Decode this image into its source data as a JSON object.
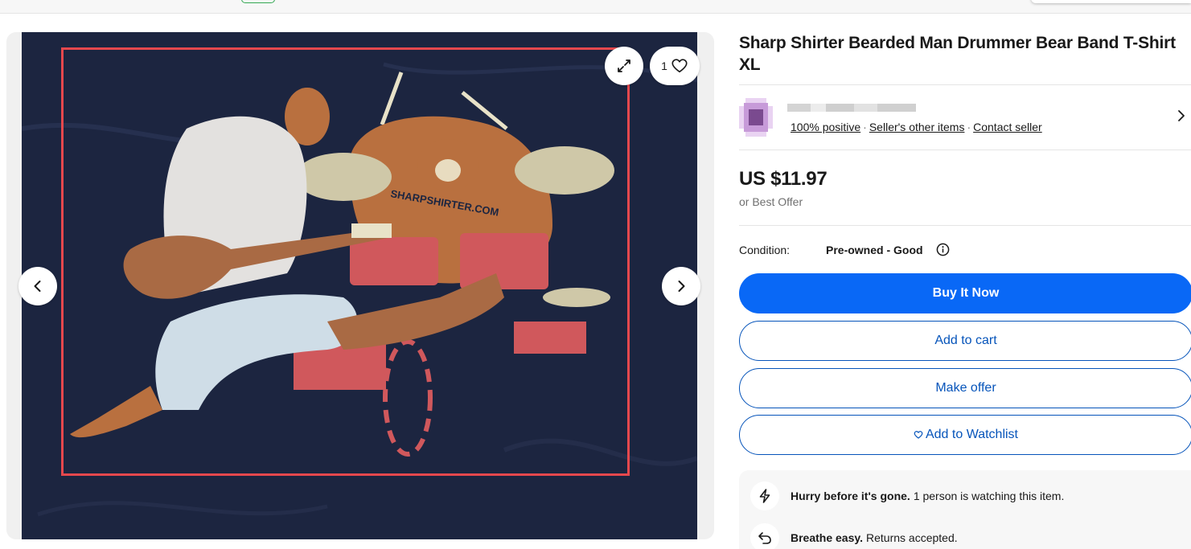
{
  "product": {
    "title": "Sharp Shirter Bearded Man Drummer Bear Band T-Shirt XL",
    "watch_count": "1",
    "image": {
      "description_text": "SHARPSHIRTER.COM"
    }
  },
  "seller": {
    "feedback": "100% positive",
    "other_items": "Seller's other items",
    "contact": "Contact seller"
  },
  "pricing": {
    "price": "US $11.97",
    "best_offer": "or Best Offer"
  },
  "condition": {
    "label": "Condition:",
    "value": "Pre-owned - Good"
  },
  "actions": {
    "buy_now": "Buy It Now",
    "add_to_cart": "Add to cart",
    "make_offer": "Make offer",
    "add_to_watchlist": "Add to Watchlist"
  },
  "signals": [
    {
      "bold": "Hurry before it's gone.",
      "text": "1 person is watching this item.",
      "icon": "lightning-icon"
    },
    {
      "bold": "Breathe easy.",
      "text": "Returns accepted.",
      "icon": "return-arrow-icon"
    }
  ],
  "colors": {
    "primary_blue": "#0968f6",
    "outline_blue": "#0654ba",
    "annotation_red": "#e5484d",
    "shirt_navy": "#1c2540"
  }
}
